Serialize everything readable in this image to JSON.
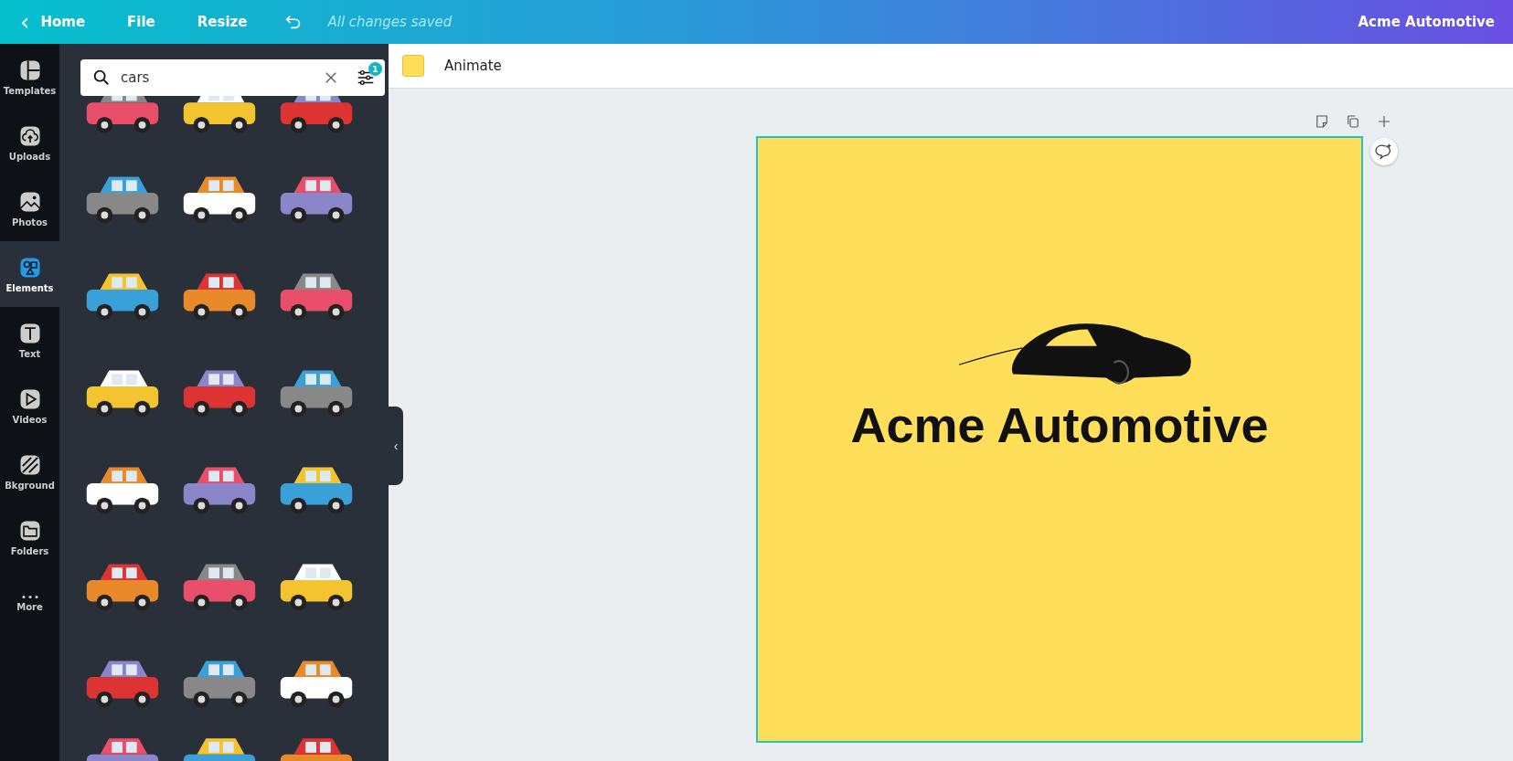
{
  "top_bar": {
    "back": "‹",
    "menu": [
      {
        "label": "Home"
      },
      {
        "label": "File"
      },
      {
        "label": "Resize"
      }
    ],
    "status": "All changes saved",
    "design_title": "Acme Automotive"
  },
  "sidebar": {
    "items": [
      {
        "label": "Templates",
        "selected": false
      },
      {
        "label": "Uploads",
        "selected": false
      },
      {
        "label": "Photos",
        "selected": false
      },
      {
        "label": "Elements",
        "selected": true
      },
      {
        "label": "Text",
        "selected": false
      },
      {
        "label": "Videos",
        "selected": false
      },
      {
        "label": "Bkground",
        "selected": false
      },
      {
        "label": "Folders",
        "selected": false
      },
      {
        "label": "More",
        "selected": false
      }
    ]
  },
  "search": {
    "value": "cars",
    "filter_count": "1"
  },
  "collapse_handle": "‹",
  "toolbar": {
    "color": "#ffde59",
    "animate": "Animate"
  },
  "design": {
    "title": "Acme Automotive",
    "selected": true
  }
}
